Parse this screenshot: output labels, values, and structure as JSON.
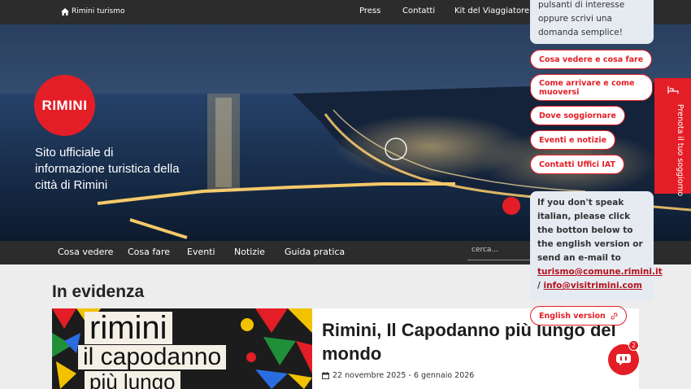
{
  "topbar": {
    "brand_label": "Rimini turismo",
    "links": [
      "Press",
      "Contatti",
      "Kit del Viaggiatore"
    ]
  },
  "hero": {
    "logo_text": "RIMINI",
    "tagline": "Sito ufficiale di informazione turistica della città di Rimini"
  },
  "main_nav": {
    "items": [
      "Cosa vedere",
      "Cosa fare",
      "Eventi",
      "Notizie",
      "Guida pratica"
    ],
    "search_placeholder": "cerca..."
  },
  "featured": {
    "section_title": "In evidenza",
    "card": {
      "image_text": {
        "line1": "rimini",
        "line2": "il capodanno",
        "line3": "più lungo"
      },
      "title": "Rimini, Il Capodanno più lungo del mondo",
      "date": "22 novembre 2025 - 6 gennaio 2026"
    }
  },
  "booking_tab": {
    "label": "Prenota il tuo soggiorno"
  },
  "chat": {
    "intro_text": "pulsanti di interesse oppure scrivi una domanda semplice!",
    "quick_replies": [
      "Cosa vedere e cosa fare",
      "Come arrivare e come muoversi",
      "Dove soggiornare",
      "Eventi e notizie",
      "Contatti Uffici IAT"
    ],
    "english_message": "If you don't speak italian, please click the botton below to the english version or send an e-mail to",
    "email_1": "turismo@comune.rimini.it",
    "separator": "/",
    "email_2": "info@visitrimini.com",
    "english_button": "English version",
    "badge_count": "2"
  },
  "colors": {
    "brand_red": "#e41e26",
    "dark_bar": "#2c2c2c",
    "chat_bubble": "#e6ebf2"
  }
}
